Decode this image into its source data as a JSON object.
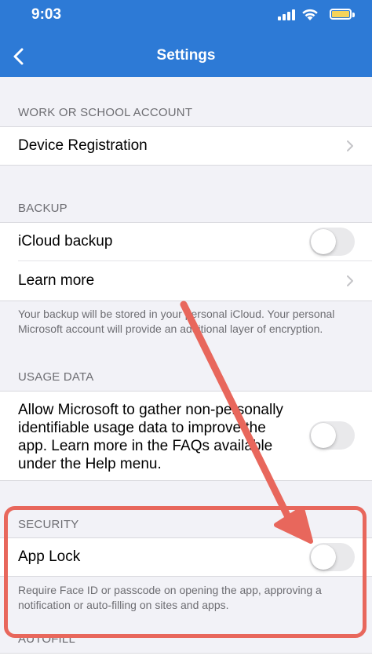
{
  "status_bar": {
    "time": "9:03"
  },
  "nav": {
    "title": "Settings"
  },
  "sections": {
    "work": {
      "header": "WORK OR SCHOOL ACCOUNT",
      "device_registration": "Device Registration"
    },
    "backup": {
      "header": "BACKUP",
      "icloud_backup": "iCloud backup",
      "learn_more": "Learn more",
      "footer": "Your backup will be stored in your personal iCloud. Your personal Microsoft account will provide an additional layer of encryption."
    },
    "usage": {
      "header": "USAGE DATA",
      "allow_text": "Allow Microsoft to gather non-personally identifiable usage data to improve the app. Learn more in the FAQs available under the Help menu."
    },
    "security": {
      "header": "SECURITY",
      "app_lock": "App Lock",
      "footer": "Require Face ID or passcode on opening the app, approving a notification or auto-filling on sites and apps."
    },
    "autofill": {
      "header": "AUTOFILL"
    }
  },
  "toggles": {
    "icloud_backup_on": false,
    "usage_data_on": false,
    "app_lock_on": false
  },
  "colors": {
    "header_bg": "#2d7ad6",
    "annotation": "#e8675c",
    "battery": "#f5d35a"
  }
}
